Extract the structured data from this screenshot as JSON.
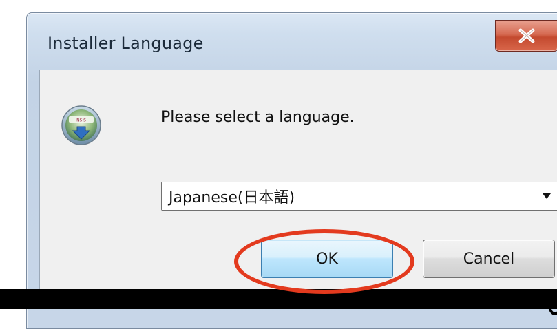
{
  "window": {
    "title": "Installer Language",
    "close_icon": "close-icon",
    "app_icon": "installer-app-icon",
    "app_icon_label": "NSIS"
  },
  "dialog": {
    "prompt": "Please select a language.",
    "language_select": {
      "selected": "Japanese(日本語)",
      "arrow_icon": "dropdown-arrow-icon"
    },
    "buttons": {
      "ok_label": "OK",
      "cancel_label": "Cancel"
    }
  },
  "annotation": {
    "highlight_color": "#e33a1e",
    "highlight_target": "ok-button"
  },
  "colors": {
    "close_button": "#c44a2f",
    "ok_button_border": "#3c7fb1",
    "client_background": "#f0f0f0"
  }
}
